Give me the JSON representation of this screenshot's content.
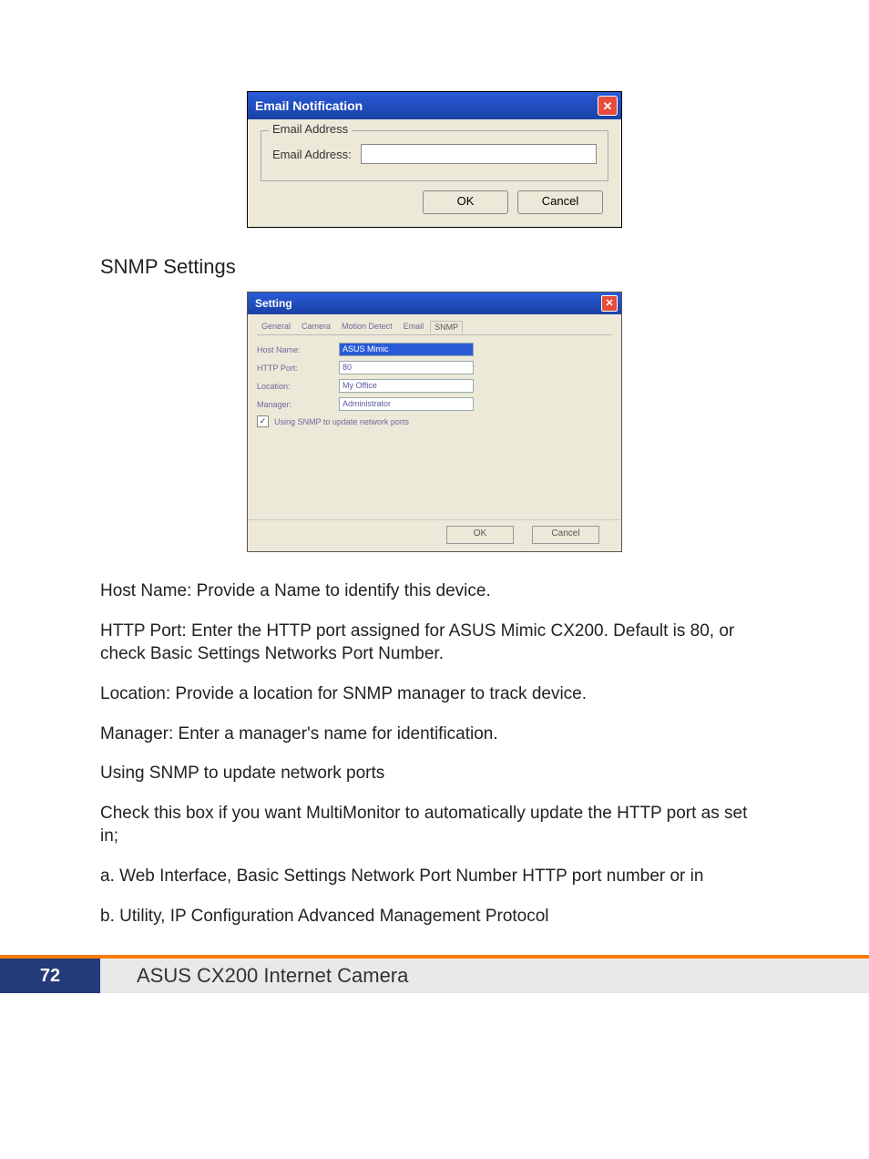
{
  "email_dialog": {
    "title": "Email Notification",
    "close_glyph": "✕",
    "group_label": "Email Address",
    "field_label": "Email Address:",
    "ok_label": "OK",
    "cancel_label": "Cancel"
  },
  "section_heading": "SNMP Settings",
  "snmp_dialog": {
    "title": "Setting",
    "close_glyph": "✕",
    "tabs": {
      "general": "General",
      "camera": "Camera",
      "motion": "Motion Detect",
      "email": "Email",
      "snmp": "SNMP"
    },
    "labels": {
      "host": "Host Name:",
      "http": "HTTP Port:",
      "location": "Location:",
      "manager": "Manager:"
    },
    "values": {
      "host": "ASUS Mimic",
      "http": "80",
      "location": "My Office",
      "manager": "Administrator"
    },
    "checkbox_label": "Using SNMP to update network ports",
    "check_glyph": "✓",
    "ok_label": "OK",
    "cancel_label": "Cancel"
  },
  "paragraphs": {
    "p1": "Host Name: Provide a Name to identify this device.",
    "p2": "HTTP Port: Enter the HTTP port assigned for ASUS Mimic CX200.  Default is 80, or check Basic Settings  Networks  Port Number.",
    "p3": "Location: Provide a location for SNMP manager to track device.",
    "p4": "Manager:    Enter a manager's name for identification.",
    "p5": "Using SNMP to update network ports",
    "p6": "Check this box if you want MultiMonitor to automatically update the HTTP port as set in;",
    "p7": "a. Web Interface, Basic Settings  Network  Port Number  HTTP port number or in",
    "p8": "b. Utility, IP Configuration  Advanced  Management Protocol"
  },
  "footer": {
    "page_number": "72",
    "title": "ASUS CX200 Internet Camera"
  }
}
